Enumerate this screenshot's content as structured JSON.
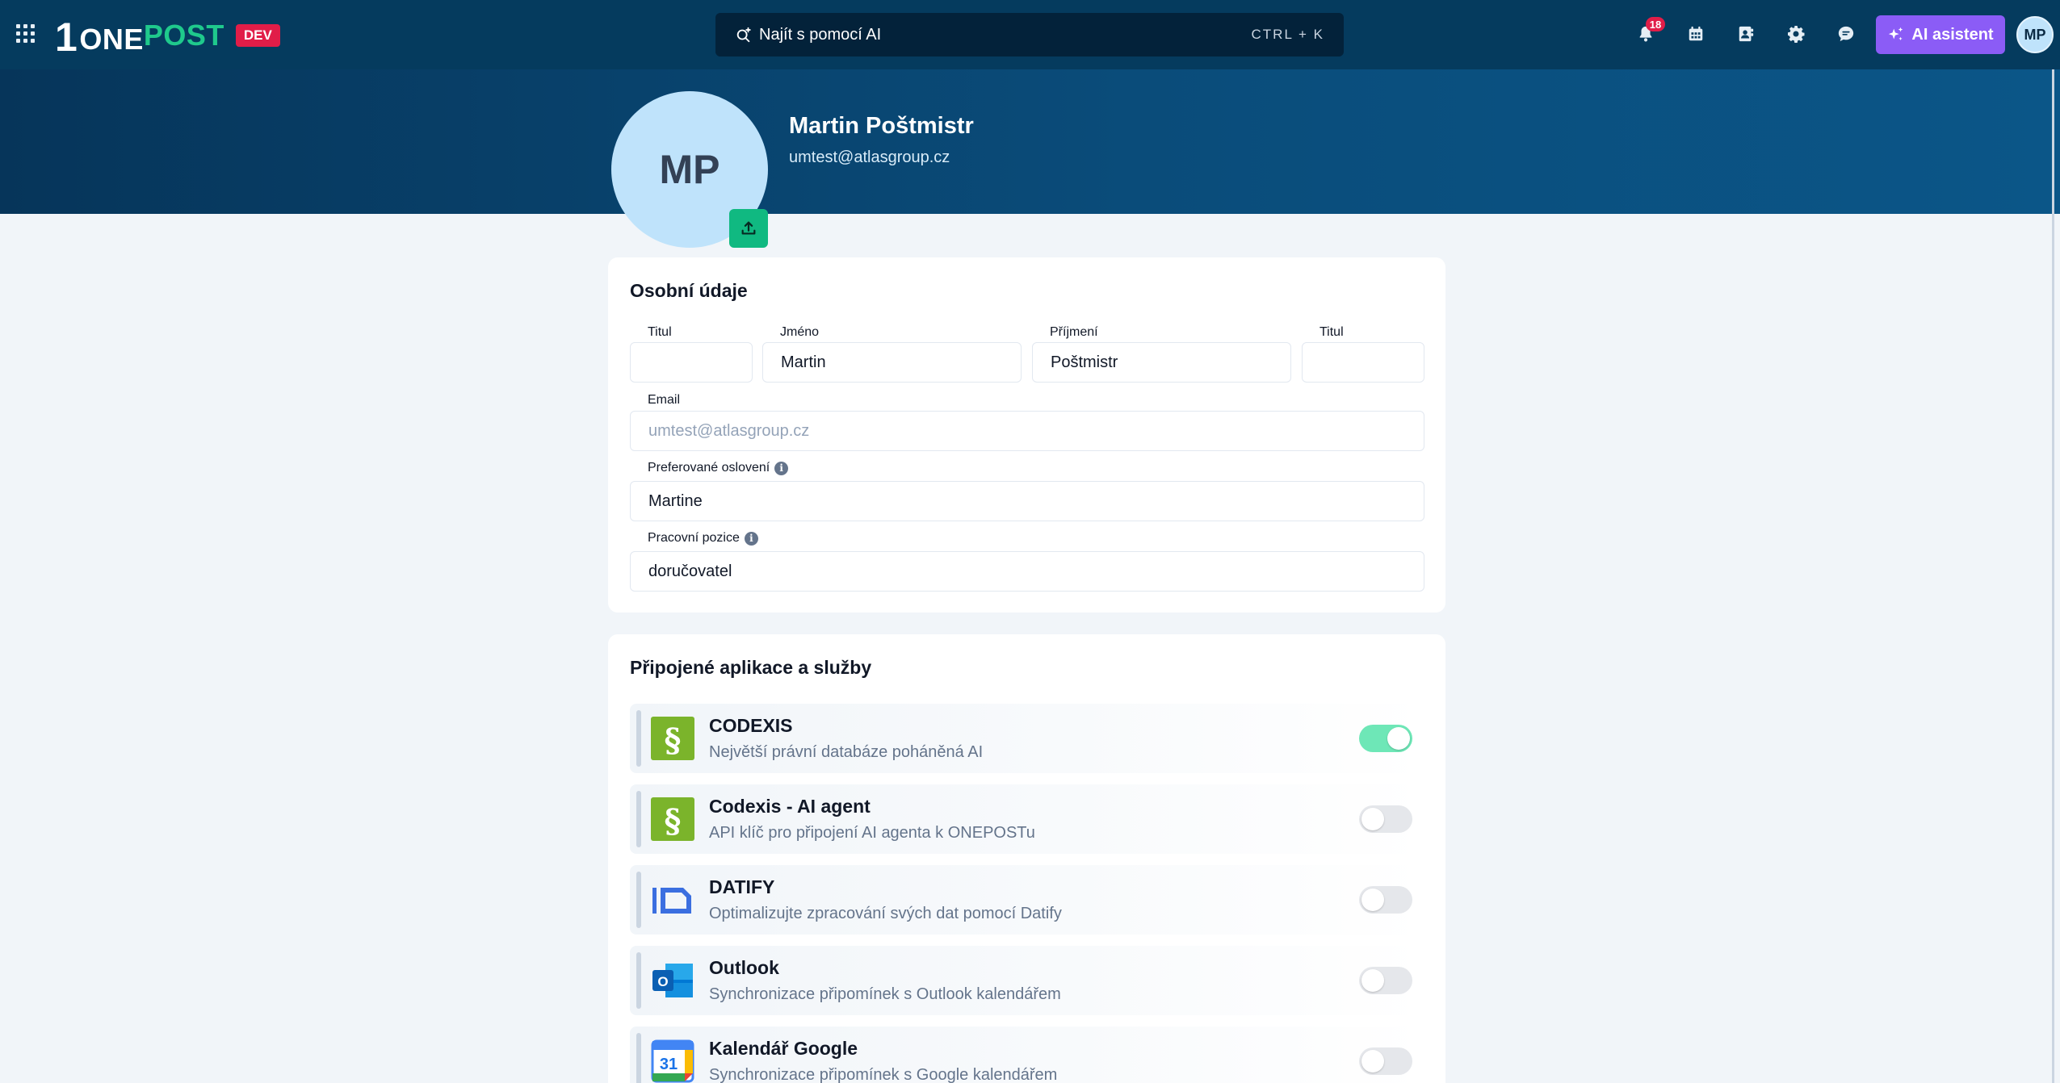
{
  "app": {
    "logo_digit": "1",
    "logo_one": "ONE",
    "logo_post": "POST",
    "env_badge": "DEV"
  },
  "topbar": {
    "search_label": "Najít s pomocí AI",
    "search_shortcut": "CTRL + K",
    "notification_count": "18",
    "ai_button_label": "AI asistent",
    "user_initials": "MP",
    "icons": [
      "apps-grid-icon",
      "search-sparkle-icon",
      "bell-icon",
      "calendar-icon",
      "contacts-icon",
      "gear-icon",
      "chat-icon",
      "sparkles-icon"
    ]
  },
  "profile": {
    "initials": "MP",
    "name": "Martin Poštmistr",
    "email": "umtest@atlasgroup.cz"
  },
  "personal": {
    "title": "Osobní údaje",
    "title_before_label": "Titul",
    "title_before_value": "",
    "first_name_label": "Jméno",
    "first_name_value": "Martin",
    "last_name_label": "Příjmení",
    "last_name_value": "Poštmistr",
    "title_after_label": "Titul",
    "title_after_value": "",
    "email_label": "Email",
    "email_value": "umtest@atlasgroup.cz",
    "salutation_label": "Preferované oslovení",
    "salutation_value": "Martine",
    "position_label": "Pracovní pozice",
    "position_value": "doručovatel",
    "info_glyph": "i"
  },
  "apps": {
    "title": "Připojené aplikace a služby",
    "items": [
      {
        "name": "CODEXIS",
        "description": "Největší právní databáze poháněná AI",
        "enabled": true,
        "icon": "codexis-icon"
      },
      {
        "name": "Codexis - AI agent",
        "description": "API klíč pro připojení AI agenta k ONEPOSTu",
        "enabled": false,
        "icon": "codexis-icon"
      },
      {
        "name": "DATIFY",
        "description": "Optimalizujte zpracování svých dat pomocí Datify",
        "enabled": false,
        "icon": "datify-icon"
      },
      {
        "name": "Outlook",
        "description": "Synchronizace připomínek s Outlook kalendářem",
        "enabled": false,
        "icon": "outlook-icon"
      },
      {
        "name": "Kalendář Google",
        "description": "Synchronizace připomínek s Google kalendářem",
        "enabled": false,
        "icon": "google-calendar-icon",
        "icon_text": "31"
      }
    ]
  },
  "colors": {
    "topbar": "#053b5e",
    "brand_green": "#1fc98c",
    "dev_badge": "#e11d48",
    "ai_purple": "#8b5cf6",
    "toggle_on": "#6ee7b7",
    "page_bg": "#f1f5f9"
  }
}
